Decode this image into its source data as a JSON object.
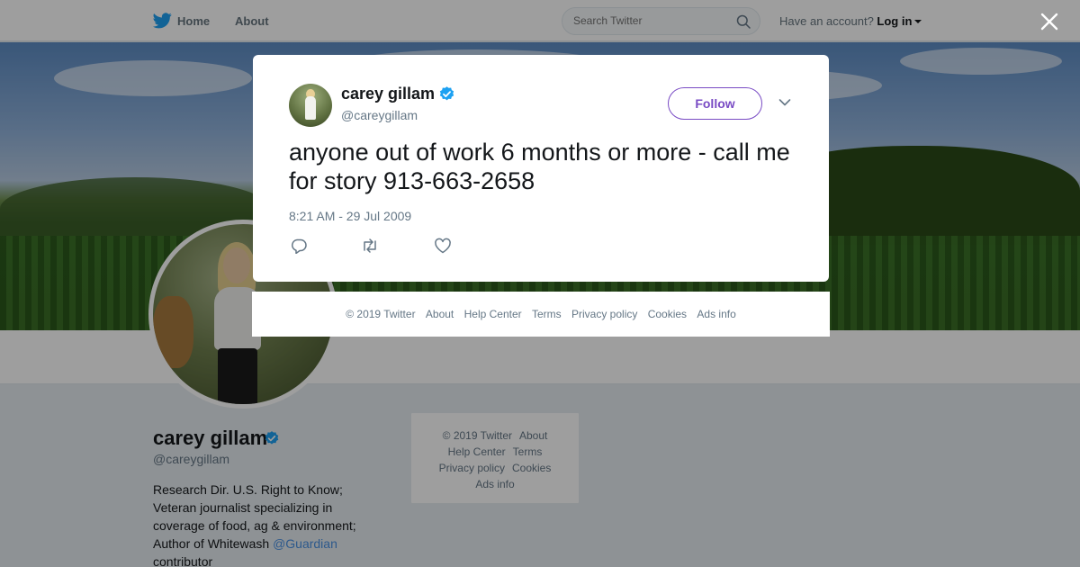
{
  "nav": {
    "home": "Home",
    "about": "About",
    "search_placeholder": "Search Twitter",
    "account_prompt": "Have an account?",
    "login": "Log in"
  },
  "profile": {
    "name": "carey gillam",
    "handle": "@careygillam",
    "bio_line1": "Research Dir. U.S. Right to Know;",
    "bio_line2": "Veteran journalist specializing in",
    "bio_line3": "coverage of food, ag & environment;",
    "bio_line4_prefix": "Author of Whitewash",
    "bio_mention": "@Guardian",
    "bio_line5": "contributor"
  },
  "side_footer": {
    "copyright": "© 2019 Twitter",
    "about": "About",
    "help": "Help Center",
    "terms": "Terms",
    "privacy": "Privacy policy",
    "cookies": "Cookies",
    "ads": "Ads info"
  },
  "tweet": {
    "name": "carey gillam",
    "handle": "@careygillam",
    "follow_label": "Follow",
    "text": "anyone out of work 6 months or more - call me for story 913-663-2658",
    "timestamp": "8:21 AM - 29 Jul 2009"
  },
  "modal_footer": {
    "copyright": "© 2019 Twitter",
    "about": "About",
    "help": "Help Center",
    "terms": "Terms",
    "privacy": "Privacy policy",
    "cookies": "Cookies",
    "ads": "Ads info"
  },
  "colors": {
    "verified": "#1da1f2",
    "follow_accent": "#794bc4",
    "mention": "#4a90e2",
    "overlay": "rgba(0,0,0,0.38)"
  },
  "icons": [
    "twitter-bird-icon",
    "search-icon",
    "close-icon",
    "verified-badge-icon",
    "chevron-down-icon",
    "reply-icon",
    "retweet-icon",
    "like-icon"
  ]
}
